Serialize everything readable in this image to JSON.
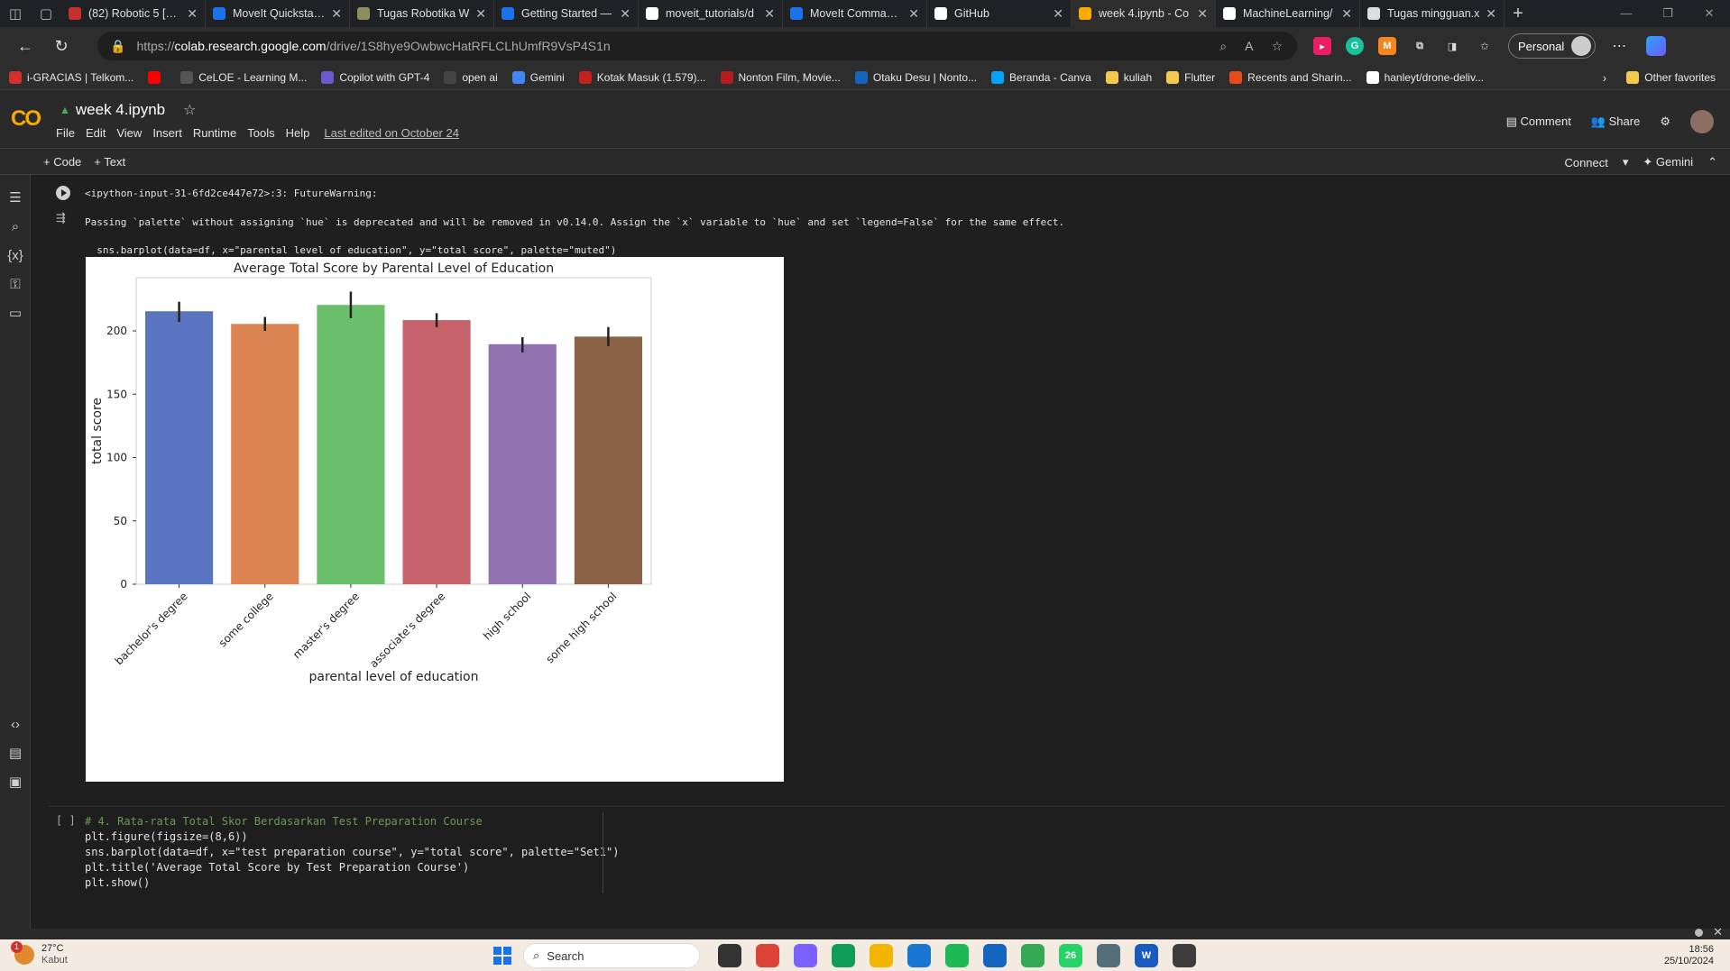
{
  "browser": {
    "tabs": [
      {
        "title": "(82) Robotic 5 [202",
        "color": "#c4302b",
        "icon": "youtube-icon"
      },
      {
        "title": "MoveIt Quickstart i",
        "color": "#1a73e8",
        "icon": "chevron-icon"
      },
      {
        "title": "Tugas Robotika W",
        "color": "#8d8d60",
        "icon": "doc-icon"
      },
      {
        "title": "Getting Started —",
        "color": "#1a73e8",
        "icon": "chevron-icon"
      },
      {
        "title": "moveit_tutorials/d",
        "color": "#ffffff",
        "icon": "github-icon"
      },
      {
        "title": "MoveIt Commande",
        "color": "#1a73e8",
        "icon": "chevron-icon"
      },
      {
        "title": "GitHub",
        "color": "#ffffff",
        "icon": "github-icon"
      },
      {
        "title": "week 4.ipynb - Co",
        "color": "#f9ab00",
        "icon": "colab-icon",
        "active": true
      },
      {
        "title": "MachineLearning/",
        "color": "#ffffff",
        "icon": "github-icon"
      },
      {
        "title": "Tugas mingguan.x",
        "color": "#dddddd",
        "icon": "file-icon"
      }
    ],
    "url_scheme": "https://",
    "url_domain": "colab.research.google.com",
    "url_path": "/drive/1S8hye9OwbwcHatRFLCLhUmfR9VsP4S1n",
    "profile_label": "Personal",
    "bookmarks": [
      {
        "label": "i-GRACIAS | Telkom...",
        "color": "#d32f2f"
      },
      {
        "label": "",
        "color": "#ff0000"
      },
      {
        "label": "CeLOE - Learning M...",
        "color": "#555555"
      },
      {
        "label": "Copilot with GPT-4",
        "color": "#6a5acd"
      },
      {
        "label": "open ai",
        "color": "#444444"
      },
      {
        "label": "Gemini",
        "color": "#4285f4"
      },
      {
        "label": "Kotak Masuk (1.579)...",
        "color": "#c5221f"
      },
      {
        "label": "Nonton Film, Movie...",
        "color": "#b71c1c"
      },
      {
        "label": "Otaku Desu | Nonto...",
        "color": "#1565c0"
      },
      {
        "label": "Beranda - Canva",
        "color": "#00a3ff"
      },
      {
        "label": "kuliah",
        "color": "#f2c94c"
      },
      {
        "label": "Flutter",
        "color": "#f2c94c"
      },
      {
        "label": "Recents and Sharin...",
        "color": "#e64a19"
      },
      {
        "label": "hanleyt/drone-deliv...",
        "color": "#ffffff"
      }
    ],
    "other_favorites": "Other favorites"
  },
  "colab": {
    "logo": "CO",
    "notebook_title": "week 4.ipynb",
    "menu": [
      "File",
      "Edit",
      "View",
      "Insert",
      "Runtime",
      "Tools",
      "Help"
    ],
    "last_edited": "Last edited on October 24",
    "comment_label": "Comment",
    "share_label": "Share",
    "add_code_label": "+ Code",
    "add_text_label": "+ Text",
    "connect_label": "Connect",
    "gemini_label": "✦ Gemini"
  },
  "output": {
    "warning_line1": "<ipython-input-31-6fd2ce447e72>:3: FutureWarning:",
    "warning_line2": "Passing `palette` without assigning `hue` is deprecated and will be removed in v0.14.0. Assign the `x` variable to `hue` and set `legend=False` for the same effect.",
    "warning_line3": "  sns.barplot(data=df, x=\"parental level of education\", y=\"total score\", palette=\"muted\")"
  },
  "chart_data": {
    "type": "bar",
    "title": "Average Total Score by Parental Level of Education",
    "xlabel": "parental level of education",
    "ylabel": "total score",
    "categories": [
      "bachelor's degree",
      "some college",
      "master's degree",
      "associate's degree",
      "high school",
      "some high school"
    ],
    "values": [
      215.5,
      205.5,
      220.5,
      208.5,
      189.5,
      195.5
    ],
    "ci_low": [
      207,
      200,
      210,
      203,
      183,
      188
    ],
    "ci_high": [
      223,
      211,
      231,
      214,
      195,
      203
    ],
    "colors": [
      "#5975c0",
      "#dd8453",
      "#6cbf6a",
      "#c6626a",
      "#9271b1",
      "#8b6245"
    ],
    "yticks": [
      0,
      50,
      100,
      150,
      200
    ],
    "ylim": [
      0,
      242
    ]
  },
  "code_cell": {
    "bracket": "[ ]",
    "lines": [
      "# 4. Rata-rata Total Skor Berdasarkan Test Preparation Course",
      "plt.figure(figsize=(8,6))",
      "sns.barplot(data=df, x=\"test preparation course\", y=\"total score\", palette=\"Set1\")",
      "plt.title('Average Total Score by Test Preparation Course')",
      "plt.show()"
    ]
  },
  "taskbar": {
    "temperature": "27°C",
    "weather": "Kabut",
    "weather_badge": "1",
    "search_placeholder": "Search",
    "time": "18:56",
    "date": "25/10/2024",
    "apps": [
      {
        "name": "taskview-icon",
        "color": "#333333",
        "label": ""
      },
      {
        "name": "chrome-icon",
        "color": "#db4437",
        "label": ""
      },
      {
        "name": "copilot-icon",
        "color": "#7b61ff",
        "label": ""
      },
      {
        "name": "edge-icon",
        "color": "#0f9d58",
        "label": ""
      },
      {
        "name": "explorer-icon",
        "color": "#f2b600",
        "label": ""
      },
      {
        "name": "store-icon",
        "color": "#1976d2",
        "label": ""
      },
      {
        "name": "spotify-icon",
        "color": "#1db954",
        "label": ""
      },
      {
        "name": "vscode-icon",
        "color": "#1565c0",
        "label": ""
      },
      {
        "name": "chrome2-icon",
        "color": "#34a853",
        "label": ""
      },
      {
        "name": "whatsapp-icon",
        "color": "#25d366",
        "label": "26"
      },
      {
        "name": "settings-icon",
        "color": "#546e7a",
        "label": ""
      },
      {
        "name": "word-icon",
        "color": "#185abd",
        "label": "W"
      },
      {
        "name": "sublime-icon",
        "color": "#3d3d3d",
        "label": ""
      }
    ]
  }
}
